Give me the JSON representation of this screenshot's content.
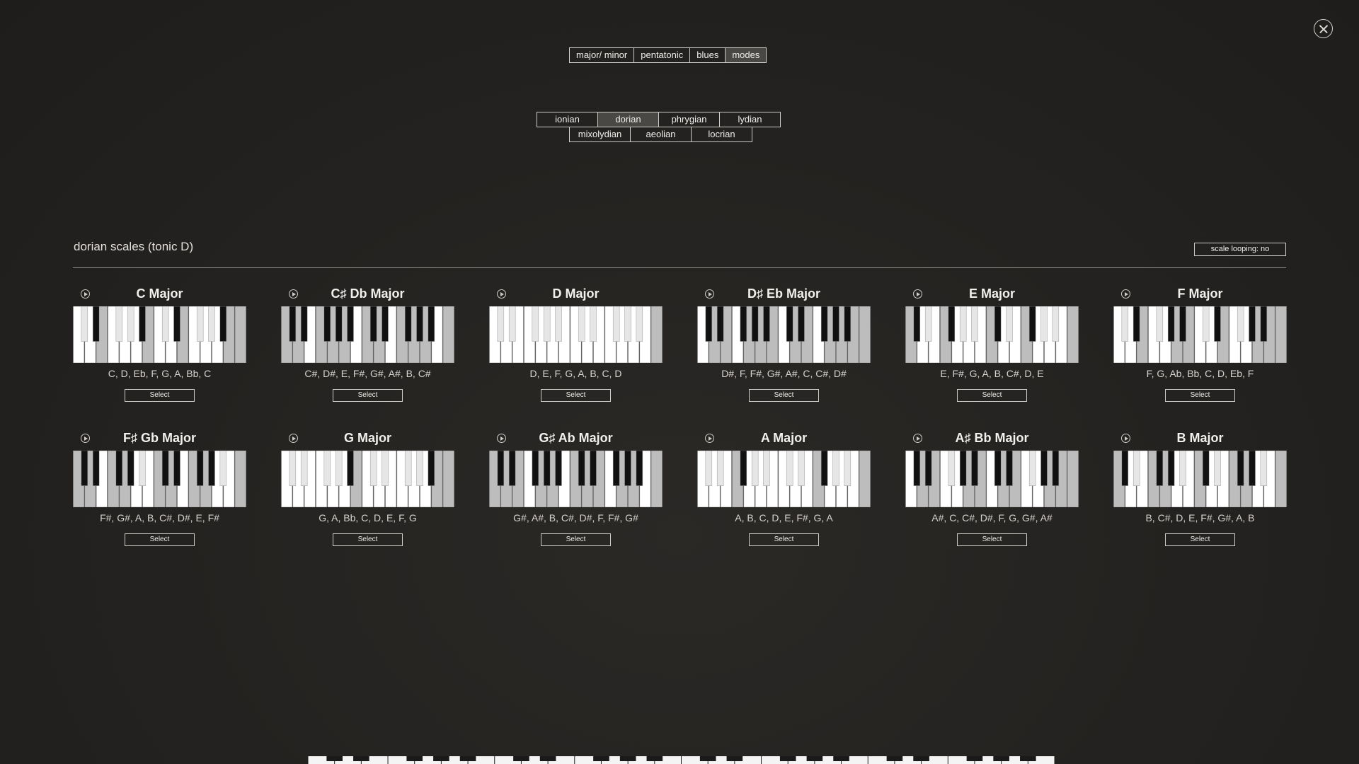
{
  "close": {
    "icon": "close-icon"
  },
  "main_tabs": [
    {
      "label": "major/ minor",
      "active": false
    },
    {
      "label": "pentatonic",
      "active": false
    },
    {
      "label": "blues",
      "active": false
    },
    {
      "label": "modes",
      "active": true
    }
  ],
  "modes_row1": [
    {
      "label": "ionian",
      "active": false
    },
    {
      "label": "dorian",
      "active": true
    },
    {
      "label": "phrygian",
      "active": false
    },
    {
      "label": "lydian",
      "active": false
    }
  ],
  "modes_row2": [
    {
      "label": "mixolydian",
      "active": false
    },
    {
      "label": "aeolian",
      "active": false
    },
    {
      "label": "locrian",
      "active": false
    }
  ],
  "section": {
    "title": "dorian scales (tonic D)",
    "loop_label": "scale looping: no"
  },
  "select_label": "Select",
  "colors": {
    "white_key": "#bdbdbd",
    "white_key_lit": "#ffffff",
    "black_key_dim": "#e6e6e6",
    "black_key_lit": "#111111"
  },
  "scales": [
    {
      "title": "C Major",
      "notes": "C, D, Eb, F, G, A, Bb, C",
      "lit_pitch_classes": [
        0,
        2,
        3,
        5,
        7,
        9,
        10
      ]
    },
    {
      "title": "C♯ Db Major",
      "notes": "C#, D#, E, F#, G#, A#, B, C#",
      "lit_pitch_classes": [
        1,
        3,
        4,
        6,
        8,
        10,
        11
      ]
    },
    {
      "title": "D Major",
      "notes": "D, E, F, G, A, B, C, D",
      "lit_pitch_classes": [
        2,
        4,
        5,
        7,
        9,
        11,
        0
      ]
    },
    {
      "title": "D♯ Eb Major",
      "notes": "D#, F, F#, G#, A#, C, C#, D#",
      "lit_pitch_classes": [
        3,
        5,
        6,
        8,
        10,
        0,
        1
      ]
    },
    {
      "title": "E Major",
      "notes": "E, F#, G, A, B, C#, D, E",
      "lit_pitch_classes": [
        4,
        6,
        7,
        9,
        11,
        1,
        2
      ]
    },
    {
      "title": "F Major",
      "notes": "F, G, Ab, Bb, C, D, Eb, F",
      "lit_pitch_classes": [
        5,
        7,
        8,
        10,
        0,
        2,
        3
      ]
    },
    {
      "title": "F♯ Gb Major",
      "notes": "F#, G#, A, B, C#, D#, E, F#",
      "lit_pitch_classes": [
        6,
        8,
        9,
        11,
        1,
        3,
        4
      ]
    },
    {
      "title": "G Major",
      "notes": "G, A, Bb, C, D, E, F, G",
      "lit_pitch_classes": [
        7,
        9,
        10,
        0,
        2,
        4,
        5
      ]
    },
    {
      "title": "G♯ Ab Major",
      "notes": "G#, A#, B, C#, D#, F, F#, G#",
      "lit_pitch_classes": [
        8,
        10,
        11,
        1,
        3,
        5,
        6
      ]
    },
    {
      "title": "A Major",
      "notes": "A, B, C, D, E, F#, G, A",
      "lit_pitch_classes": [
        9,
        11,
        0,
        2,
        4,
        6,
        7
      ]
    },
    {
      "title": "A♯ Bb Major",
      "notes": "A#, C, C#, D#, F, G, G#, A#",
      "lit_pitch_classes": [
        10,
        0,
        1,
        3,
        5,
        7,
        8
      ]
    },
    {
      "title": "B Major",
      "notes": "B, C#, D, E, F#, G#, A, B",
      "lit_pitch_classes": [
        11,
        1,
        2,
        4,
        6,
        8,
        9
      ]
    }
  ]
}
